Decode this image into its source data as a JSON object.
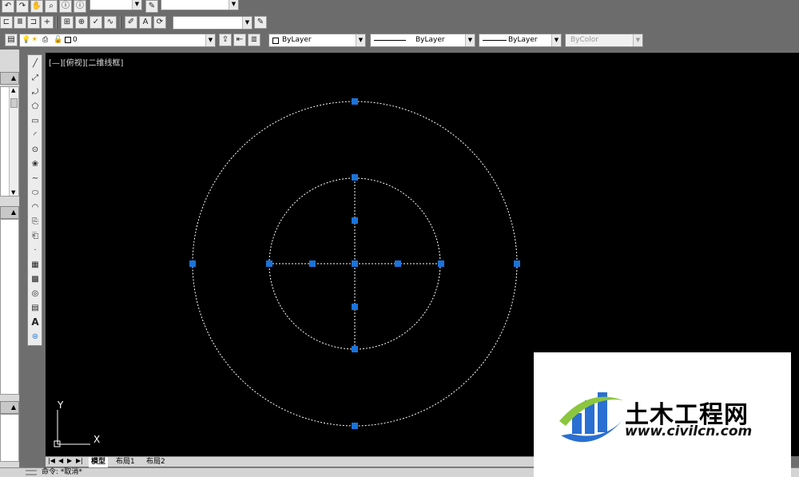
{
  "toolbar_top": {
    "layer_value": "0"
  },
  "properties": {
    "color_value": "ByLayer",
    "linetype_value": "ByLayer",
    "lineweight_value": "ByLayer",
    "plotstyle_value": "ByColor"
  },
  "viewport": {
    "label": "[—][俯视][二维线框]",
    "ucs_x": "X",
    "ucs_y": "Y"
  },
  "layout_tabs": [
    {
      "label": "模型",
      "active": true
    },
    {
      "label": "布局1",
      "active": false
    },
    {
      "label": "布局2",
      "active": false
    }
  ],
  "command_line": {
    "text": "命令: *取消*"
  },
  "watermark": {
    "name": "土木工程网",
    "url": "www.civilcn.com"
  },
  "colors": {
    "canvas_bg": "#000000",
    "geometry": "#ffffff",
    "grip": "#1a73d9"
  }
}
